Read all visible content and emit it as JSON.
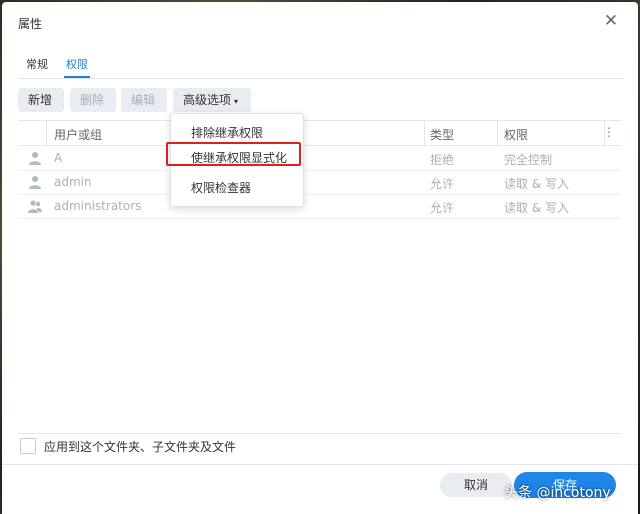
{
  "dialog": {
    "title": "属性",
    "close_glyph": "✕"
  },
  "tabs": [
    {
      "label": "常规",
      "active": false
    },
    {
      "label": "权限",
      "active": true
    }
  ],
  "toolbar": {
    "add_label": "新增",
    "delete_label": "删除",
    "edit_label": "编辑",
    "advanced_label": "高级选项",
    "caret_glyph": "▾"
  },
  "grid": {
    "columns": [
      "用户或组",
      "类型",
      "权限"
    ],
    "more_glyph": "⋮",
    "rows": [
      {
        "icon": "user-icon",
        "name": "A",
        "type": "拒绝",
        "permission": "完全控制"
      },
      {
        "icon": "user-icon",
        "name": "admin",
        "type": "允许",
        "permission": "读取 & 写入"
      },
      {
        "icon": "group-icon",
        "name": "administrators",
        "type": "允许",
        "permission": "读取 & 写入"
      }
    ]
  },
  "advanced_menu": {
    "items": [
      "排除继承权限",
      "使继承权限显式化",
      "权限检查器"
    ],
    "highlighted_index": 1,
    "highlight_color": "#e0201c"
  },
  "footer": {
    "apply_label": "应用到这个文件夹、子文件夹及文件",
    "cancel_label": "取消",
    "save_label": "保存"
  },
  "watermark": "头条 @incotony",
  "colors": {
    "accent": "#1f86e8",
    "active_tab": "#1f7ed6"
  }
}
